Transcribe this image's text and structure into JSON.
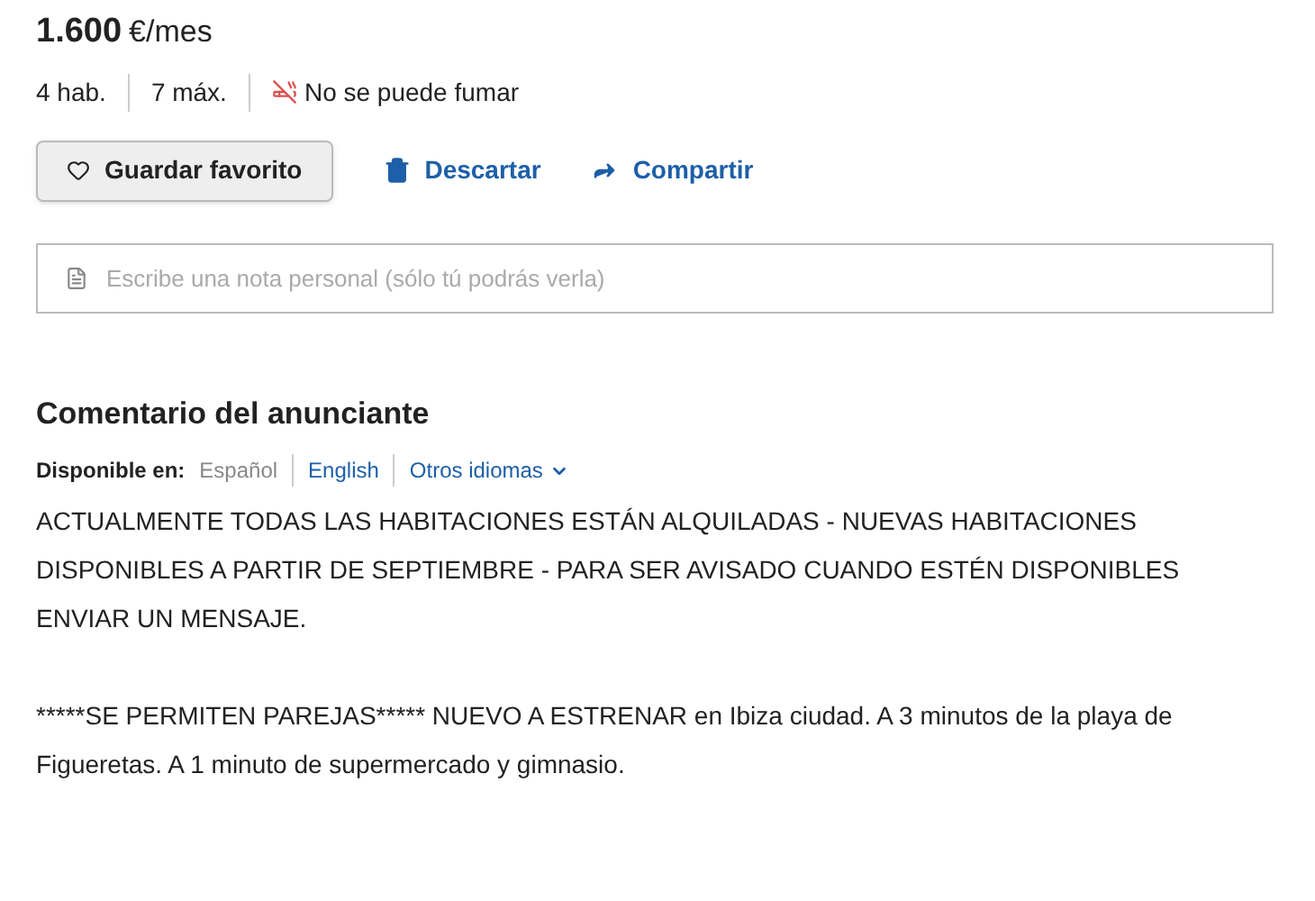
{
  "price": {
    "amount": "1.600",
    "unit": "€/mes"
  },
  "features": [
    {
      "kind": "text",
      "label": "4 hab."
    },
    {
      "kind": "text",
      "label": "7 máx."
    },
    {
      "kind": "no-smoking",
      "label": "No se puede fumar"
    }
  ],
  "actions": [
    {
      "kind": "favorite",
      "label": "Guardar favorito"
    },
    {
      "kind": "discard",
      "label": "Descartar"
    },
    {
      "kind": "share",
      "label": "Compartir"
    }
  ],
  "note": {
    "placeholder": "Escribe una nota personal (sólo tú podrás verla)"
  },
  "comment": {
    "title": "Comentario del anunciante",
    "languages_label": "Disponible en:",
    "languages": [
      {
        "label": "Español",
        "selected": true,
        "kind": "plain"
      },
      {
        "label": "English",
        "selected": false,
        "kind": "plain"
      },
      {
        "label": "Otros idiomas",
        "selected": false,
        "kind": "dropdown"
      }
    ],
    "paragraphs": [
      "ACTUALMENTE TODAS LAS HABITACIONES ESTÁN ALQUILADAS - NUEVAS HABITACIONES DISPONIBLES A PARTIR DE SEPTIEMBRE - PARA SER AVISADO CUANDO ESTÉN DISPONIBLES ENVIAR UN MENSAJE.",
      "*****SE PERMITEN PAREJAS***** NUEVO A ESTRENAR en Ibiza ciudad. A 3 minutos de la playa de Figueretas. A 1 minuto de supermercado y gimnasio."
    ]
  }
}
